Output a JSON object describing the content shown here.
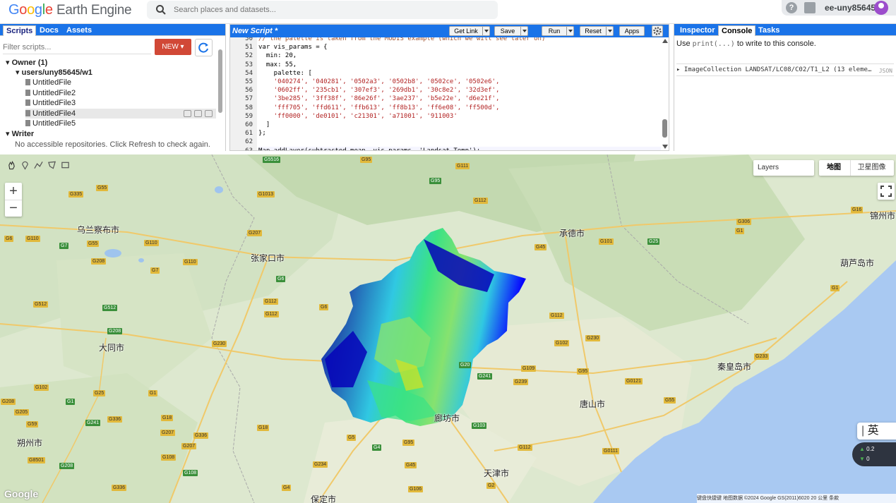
{
  "header": {
    "logo_google": [
      "G",
      "o",
      "o",
      "g",
      "l",
      "e"
    ],
    "logo_product": "Earth Engine",
    "search_placeholder": "Search places and datasets...",
    "username": "ee-uny85645"
  },
  "left_panel": {
    "tabs": [
      "Scripts",
      "Docs",
      "Assets"
    ],
    "active_tab": "Scripts",
    "filter_placeholder": "Filter scripts...",
    "new_button": "NEW",
    "tree": {
      "owner": "Owner (1)",
      "repo": "users/uny85645/w1",
      "files": [
        "UntitledFile",
        "UntitledFile2",
        "UntitledFile3",
        "UntitledFile4",
        "UntitledFile5"
      ],
      "writer": "Writer",
      "writer_note": "No accessible repositories. Click Refresh to check again."
    }
  },
  "editor": {
    "title": "New Script *",
    "buttons": {
      "get_link": "Get Link",
      "save": "Save",
      "run": "Run",
      "reset": "Reset",
      "apps": "Apps"
    },
    "lines": [
      {
        "n": "50",
        "text": "// the palette is taken from the MODIS example (which we will see later on)",
        "kind": "comment"
      },
      {
        "n": "51",
        "text": "var vis_params = {",
        "kind": "code"
      },
      {
        "n": "52",
        "text": "  min: 20,",
        "kind": "code"
      },
      {
        "n": "53",
        "text": "  max: 55,",
        "kind": "code"
      },
      {
        "n": "54",
        "text": "    palette: [",
        "kind": "code"
      },
      {
        "n": "55",
        "text": "    '040274', '040281', '0502a3', '0502b8', '0502ce', '0502e6',",
        "kind": "str"
      },
      {
        "n": "56",
        "text": "    '0602ff', '235cb1', '307ef3', '269db1', '30c8e2', '32d3ef',",
        "kind": "str"
      },
      {
        "n": "57",
        "text": "    '3be285', '3ff38f', '86e26f', '3ae237', 'b5e22e', 'd6e21f',",
        "kind": "str"
      },
      {
        "n": "58",
        "text": "    'fff705', 'ffd611', 'ffb613', 'ff8b13', 'ff6e08', 'ff500d',",
        "kind": "str"
      },
      {
        "n": "59",
        "text": "    'ff0000', 'de0101', 'c21301', 'a71001', '911003'",
        "kind": "str"
      },
      {
        "n": "60",
        "text": "  ]",
        "kind": "code"
      },
      {
        "n": "61",
        "text": "};",
        "kind": "code"
      },
      {
        "n": "62",
        "text": "",
        "kind": "code"
      },
      {
        "n": "63",
        "text": "Map.addLayer(subtracted_mean, vis_params, 'Landsat Temp');",
        "kind": "code"
      }
    ]
  },
  "right_panel": {
    "tabs": [
      "Inspector",
      "Console",
      "Tasks"
    ],
    "active_tab": "Console",
    "hint_prefix": "Use",
    "hint_code": "print(...)",
    "hint_suffix": "to write to this console.",
    "console_output": "ImageCollection LANDSAT/LC08/C02/T1_L2 (13 eleme…",
    "json_label": "JSON"
  },
  "map": {
    "layers_label": "Layers",
    "map_type_map": "地图",
    "map_type_satellite": "卫星图像",
    "cities": [
      {
        "name": "乌兰察布市"
      },
      {
        "name": "张家口市"
      },
      {
        "name": "承德市"
      },
      {
        "name": "锦州市"
      },
      {
        "name": "葫芦岛市"
      },
      {
        "name": "大同市"
      },
      {
        "name": "秦皇岛市"
      },
      {
        "name": "唐山市"
      },
      {
        "name": "廊坊市"
      },
      {
        "name": "朔州市"
      },
      {
        "name": "天津市"
      },
      {
        "name": "保定市"
      }
    ],
    "roads": [
      "G5516",
      "G95",
      "G111",
      "G335",
      "G55",
      "G95",
      "G112",
      "G1013",
      "G6",
      "G110",
      "G7",
      "G55",
      "G207",
      "G110",
      "G101",
      "G25",
      "G1",
      "G208",
      "G7",
      "G110",
      "G6",
      "G45",
      "G306",
      "G16",
      "G512",
      "G512",
      "G112",
      "G6",
      "G112",
      "G1",
      "G208",
      "G112",
      "G102",
      "G230",
      "G230",
      "G20",
      "G109",
      "G0121",
      "G102",
      "G1",
      "G241",
      "G239",
      "G95",
      "G233",
      "G25",
      "G1",
      "G55",
      "G208",
      "G205",
      "G59",
      "G241",
      "G336",
      "G18",
      "G336",
      "G18",
      "G103",
      "G1",
      "G207",
      "G207",
      "G5",
      "G4",
      "G95",
      "G112",
      "G0111",
      "G8501",
      "G208",
      "G108",
      "G234",
      "G45",
      "G2",
      "G108",
      "G106",
      "G4",
      "G336",
      "G239"
    ],
    "ime_text": "英",
    "net_up": "0.2",
    "net_down": "0",
    "google_logo": "Google",
    "attribution": "键盘快捷键  地图数据 ©2024 Google GS(2011)6020  20 公里  条款"
  },
  "colors": {
    "accent_blue": "#1a73e8",
    "new_button": "#d14836",
    "lst_palette": [
      "#040274",
      "#0502b8",
      "#0602ff",
      "#235cb1",
      "#307ef3",
      "#269db1",
      "#30c8e2",
      "#32d3ef",
      "#3be285",
      "#3ff38f",
      "#86e26f",
      "#b5e22e",
      "#d6e21f",
      "#fff705"
    ]
  }
}
